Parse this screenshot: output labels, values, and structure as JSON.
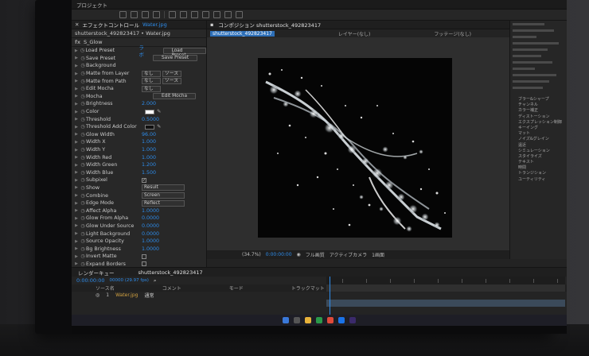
{
  "menubar": {
    "items": [
      "プロジェクト",
      "",
      "",
      "",
      "",
      ""
    ]
  },
  "effect_controls": {
    "tab_label": "エフェクトコントロール",
    "tab_layer": "Water.jpg",
    "breadcrumb": "shutterstock_492823417 • Water.jpg",
    "effect_name": "S_Glow",
    "fx_label": "fx",
    "rows": [
      {
        "type": "preset",
        "label": "Load Preset",
        "value": "ラボ",
        "button": "Load Preset"
      },
      {
        "type": "button",
        "label": "Save Preset",
        "button": "Save Preset"
      },
      {
        "type": "plain",
        "label": "Background"
      },
      {
        "type": "dropdown2",
        "label": "Matte from Layer",
        "dd1": "なし",
        "dd2": "ソース"
      },
      {
        "type": "dropdown2",
        "label": "Matte from Path",
        "dd1": "なし",
        "dd2": "ソース"
      },
      {
        "type": "dropdown1",
        "label": "Edit Mocha",
        "dd1": "なし"
      },
      {
        "type": "button",
        "label": "Mocha",
        "button": "Edit Mocha"
      },
      {
        "type": "value",
        "label": "Brightness",
        "value": "2.000"
      },
      {
        "type": "color",
        "label": "Color",
        "swatch": "#ffffff"
      },
      {
        "type": "value",
        "label": "Threshold",
        "value": "0.5000"
      },
      {
        "type": "color",
        "label": "Threshold Add Color",
        "swatch": "#111111"
      },
      {
        "type": "value",
        "label": "Glow Width",
        "value": "96.00"
      },
      {
        "type": "value",
        "label": "Width X",
        "value": "1.000"
      },
      {
        "type": "value",
        "label": "Width Y",
        "value": "1.000"
      },
      {
        "type": "value",
        "label": "Width Red",
        "value": "1.000"
      },
      {
        "type": "value",
        "label": "Width Green",
        "value": "1.200"
      },
      {
        "type": "value",
        "label": "Width Blue",
        "value": "1.500"
      },
      {
        "type": "check",
        "label": "Subpixel",
        "checked": true
      },
      {
        "type": "dropdownwide",
        "label": "Show",
        "dd1": "Result"
      },
      {
        "type": "dropdownwide",
        "label": "Combine",
        "dd1": "Screen"
      },
      {
        "type": "dropdownwide",
        "label": "Edge Mode",
        "dd1": "Reflect"
      },
      {
        "type": "value",
        "label": "Affect Alpha",
        "value": "1.0000"
      },
      {
        "type": "value",
        "label": "Glow From Alpha",
        "value": "0.0000"
      },
      {
        "type": "value",
        "label": "Glow Under Source",
        "value": "0.0000"
      },
      {
        "type": "value",
        "label": "Light Background",
        "value": "0.0000"
      },
      {
        "type": "value",
        "label": "Source Opacity",
        "value": "1.0000"
      },
      {
        "type": "value",
        "label": "Bg Brightness",
        "value": "1.0000"
      },
      {
        "type": "check",
        "label": "Invert Matte",
        "checked": false
      },
      {
        "type": "check",
        "label": "Expand Borders",
        "checked": false
      }
    ]
  },
  "composition": {
    "tab_label": "コンポジション shutterstock_492823417",
    "tab_chip": "shutterstock_492823417",
    "layer_label": "レイヤー(なし)",
    "footage_label": "フッテージ(なし)",
    "zoom": "(34.7%)",
    "timecode": "0:00:00:00",
    "quality": "フル画質",
    "camera": "アクティブカメラ",
    "view": "1画面"
  },
  "timeline": {
    "render_tab": "レンダーキュー",
    "comp_tab": "shutterstock_492823417",
    "timecode": "0:00:00:00",
    "timecode_sub": "00000 (29.97 fps)",
    "col_source": "ソース名",
    "col_comment": "コメント",
    "col_mode": "モード",
    "col_trkmat": "トラックマット",
    "layer_num": "1",
    "layer_name": "Water.jpg",
    "layer_mode": "通常"
  },
  "right_panel": {
    "items": [
      "ブラー&シャープ",
      "チャンネル",
      "カラー補正",
      "ディストーション",
      "エクスプレッション制御",
      "キーイング",
      "マット",
      "ノイズ&グレイン",
      "遠近",
      "シミュレーション",
      "スタイライズ",
      "テキスト",
      "時間",
      "トランジション",
      "ユーティリティ"
    ]
  },
  "colors": {
    "accent": "#2d8ceb",
    "panel": "#282828",
    "layer_label": "#d0a040"
  }
}
